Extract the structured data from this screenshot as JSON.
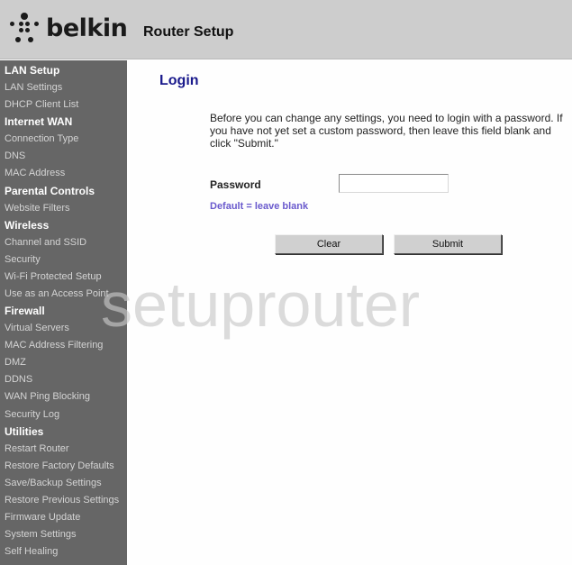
{
  "header": {
    "brand": "belkin",
    "logo_icon": "belkin-dots-logo",
    "app_title": "Router Setup"
  },
  "sidebar": {
    "sections": [
      {
        "title": "LAN Setup",
        "items": [
          "LAN Settings",
          "DHCP Client List"
        ]
      },
      {
        "title": "Internet WAN",
        "items": [
          "Connection Type",
          "DNS",
          "MAC Address"
        ]
      },
      {
        "title": "Parental Controls",
        "items": [
          "Website Filters"
        ]
      },
      {
        "title": "Wireless",
        "items": [
          "Channel and SSID",
          "Security",
          "Wi-Fi Protected Setup",
          "Use as an Access Point"
        ]
      },
      {
        "title": "Firewall",
        "items": [
          "Virtual Servers",
          "MAC Address Filtering",
          "DMZ",
          "DDNS",
          "WAN Ping Blocking",
          "Security Log"
        ]
      },
      {
        "title": "Utilities",
        "items": [
          "Restart Router",
          "Restore Factory Defaults",
          "Save/Backup Settings",
          "Restore Previous Settings",
          "Firmware Update",
          "System Settings",
          "Self Healing"
        ]
      }
    ]
  },
  "main": {
    "title": "Login",
    "intro": "Before you can change any settings, you need to login with a password. If you have not yet set a custom password, then leave this field blank and click \"Submit.\"",
    "password_label": "Password",
    "password_value": "",
    "password_hint": "Default = leave blank",
    "clear_label": "Clear",
    "submit_label": "Submit"
  },
  "watermark": "setuprouter",
  "colors": {
    "header_bg": "#cdcdcd",
    "sidebar_bg": "#666666",
    "title_blue": "#1a1a8c",
    "hint_purple": "#6a5acd"
  }
}
